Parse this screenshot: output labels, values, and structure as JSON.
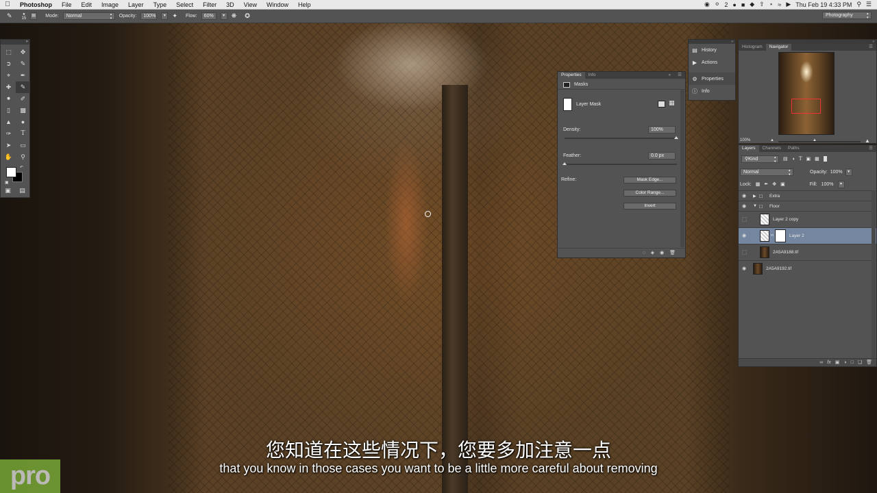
{
  "menubar": {
    "app": "Photoshop",
    "items": [
      "File",
      "Edit",
      "Image",
      "Layer",
      "Type",
      "Select",
      "Filter",
      "3D",
      "View",
      "Window",
      "Help"
    ],
    "status_badge": "2",
    "clock": "Thu Feb 19  4:33 PM"
  },
  "options": {
    "brush_size": "15",
    "mode_label": "Mode:",
    "mode_value": "Normal",
    "opacity_label": "Opacity:",
    "opacity_value": "100%",
    "flow_label": "Flow:",
    "flow_value": "60%",
    "workspace": "Photography"
  },
  "properties": {
    "tabs": [
      "Properties",
      "Info"
    ],
    "section": "Masks",
    "mask_type": "Layer Mask",
    "density_label": "Density:",
    "density_value": "100%",
    "feather_label": "Feather:",
    "feather_value": "0.0 px",
    "refine_label": "Refine:",
    "buttons": [
      "Mask Edge...",
      "Color Range...",
      "Invert"
    ]
  },
  "dock": [
    "History",
    "Actions",
    "Properties",
    "Info"
  ],
  "navigator": {
    "tabs": [
      "Histogram",
      "Navigator"
    ],
    "zoom": "100%"
  },
  "layers": {
    "tabs": [
      "Layers",
      "Channels",
      "Paths"
    ],
    "filter": "Kind",
    "blend_mode": "Normal",
    "opacity_label": "Opacity:",
    "opacity_value": "100%",
    "lock_label": "Lock:",
    "fill_label": "Fill:",
    "fill_value": "100%",
    "rows": [
      {
        "name": "Extra",
        "kind": "group-collapsed",
        "visible": true
      },
      {
        "name": "Floor",
        "kind": "group-open",
        "visible": true
      },
      {
        "name": "Layer 2 copy",
        "kind": "layer",
        "visible": false
      },
      {
        "name": "Layer 2",
        "kind": "layer-mask",
        "visible": true,
        "active": true
      },
      {
        "name": "2A5A9188.tif",
        "kind": "layer",
        "visible": false
      },
      {
        "name": "2A5A9192.tif",
        "kind": "layer",
        "visible": true
      }
    ]
  },
  "subtitles": {
    "chinese": "您知道在这些情况下，您要多加注意一点",
    "english": "that you know in those cases you want to be a little more careful about removing"
  },
  "watermark": "pro",
  "colors": {
    "panel": "#535353",
    "active_layer": "#7486a0",
    "proxy_box": "#e33333",
    "logo_green": "#8cc63f"
  }
}
